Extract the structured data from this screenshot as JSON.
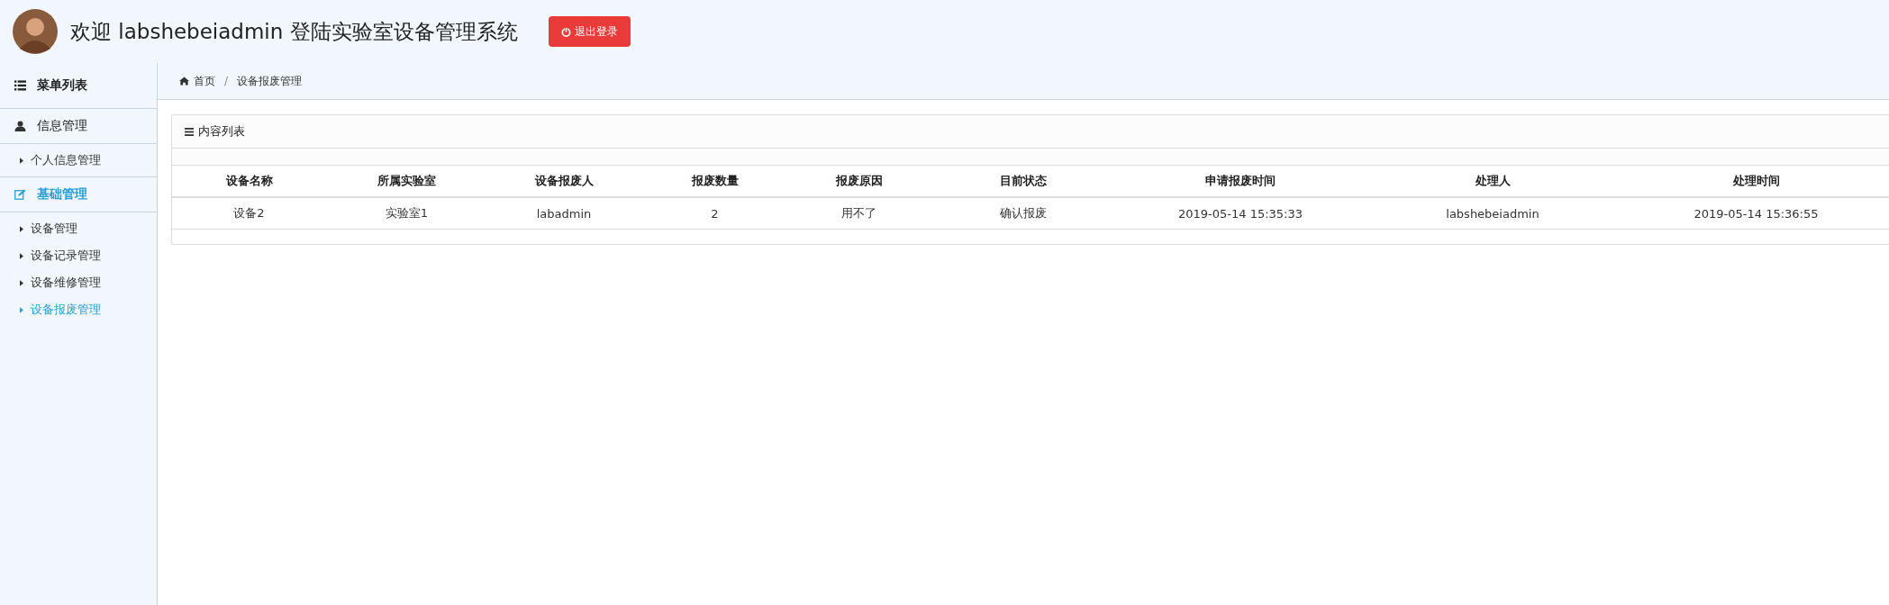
{
  "header": {
    "title": "欢迎 labshebeiadmin 登陆实验室设备管理系统",
    "logout_button": "退出登录"
  },
  "sidebar": {
    "title": "菜单列表",
    "sections": [
      {
        "label": "信息管理",
        "kind": "user",
        "selected": false,
        "items": [
          {
            "label": "个人信息管理",
            "selected": false
          }
        ]
      },
      {
        "label": "基础管理",
        "kind": "edit",
        "selected": true,
        "items": [
          {
            "label": "设备管理",
            "selected": false
          },
          {
            "label": "设备记录管理",
            "selected": false
          },
          {
            "label": "设备维修管理",
            "selected": false
          },
          {
            "label": "设备报废管理",
            "selected": true
          }
        ]
      }
    ]
  },
  "breadcrumb": [
    {
      "label": "首页",
      "kind": "home"
    },
    {
      "separator": "/",
      "label": "设备报废管理",
      "kind": "page"
    }
  ],
  "panel": {
    "title": "内容列表"
  },
  "table": {
    "columns": [
      "设备名称",
      "所属实验室",
      "设备报废人",
      "报废数量",
      "报废原因",
      "目前状态",
      "申请报废时间",
      "处理人",
      "处理时间"
    ],
    "rows": [
      [
        "设备2",
        "实验室1",
        "labadmin",
        "2",
        "用不了",
        "确认报废",
        "2019-05-14 15:35:33",
        "labshebeiadmin",
        "2019-05-14 15:36:55"
      ]
    ]
  }
}
